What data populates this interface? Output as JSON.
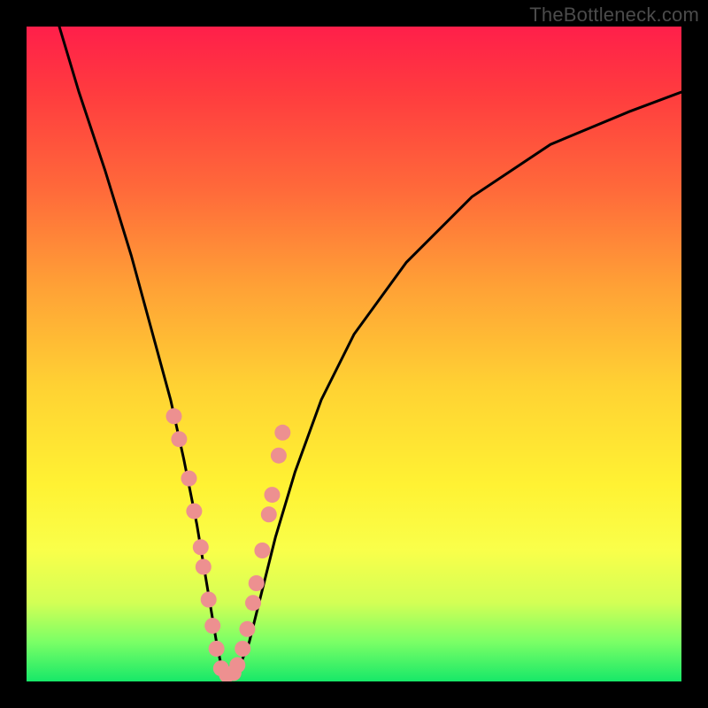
{
  "watermark": "TheBottleneck.com",
  "chart_data": {
    "type": "line",
    "title": "",
    "xlabel": "",
    "ylabel": "",
    "xlim": [
      0,
      100
    ],
    "ylim": [
      0,
      100
    ],
    "background": "gradient-heat",
    "series": [
      {
        "name": "bottleneck-curve",
        "x": [
          5,
          8,
          12,
          16,
          19,
          22,
          24,
          26,
          27.5,
          29,
          30,
          31,
          32,
          34,
          36,
          38,
          41,
          45,
          50,
          58,
          68,
          80,
          92,
          100
        ],
        "y": [
          100,
          90,
          78,
          65,
          54,
          43,
          34,
          24,
          15,
          6,
          1,
          1,
          1,
          6,
          14,
          22,
          32,
          43,
          53,
          64,
          74,
          82,
          87,
          90
        ]
      }
    ],
    "markers": {
      "name": "highlight-points",
      "x": [
        22.5,
        23.3,
        24.8,
        25.6,
        26.6,
        27.0,
        27.8,
        28.4,
        29.0,
        29.7,
        30.6,
        31.6,
        32.2,
        33.0,
        33.7,
        34.6,
        35.1,
        36.0,
        37.0,
        37.5,
        38.5,
        39.1
      ],
      "y": [
        40.5,
        37.0,
        31.0,
        26.0,
        20.5,
        17.5,
        12.5,
        8.5,
        5.0,
        2.0,
        1.0,
        1.3,
        2.5,
        5.0,
        8.0,
        12.0,
        15.0,
        20.0,
        25.5,
        28.5,
        34.5,
        38.0
      ],
      "radius": 9,
      "color": "#ed9090"
    }
  }
}
